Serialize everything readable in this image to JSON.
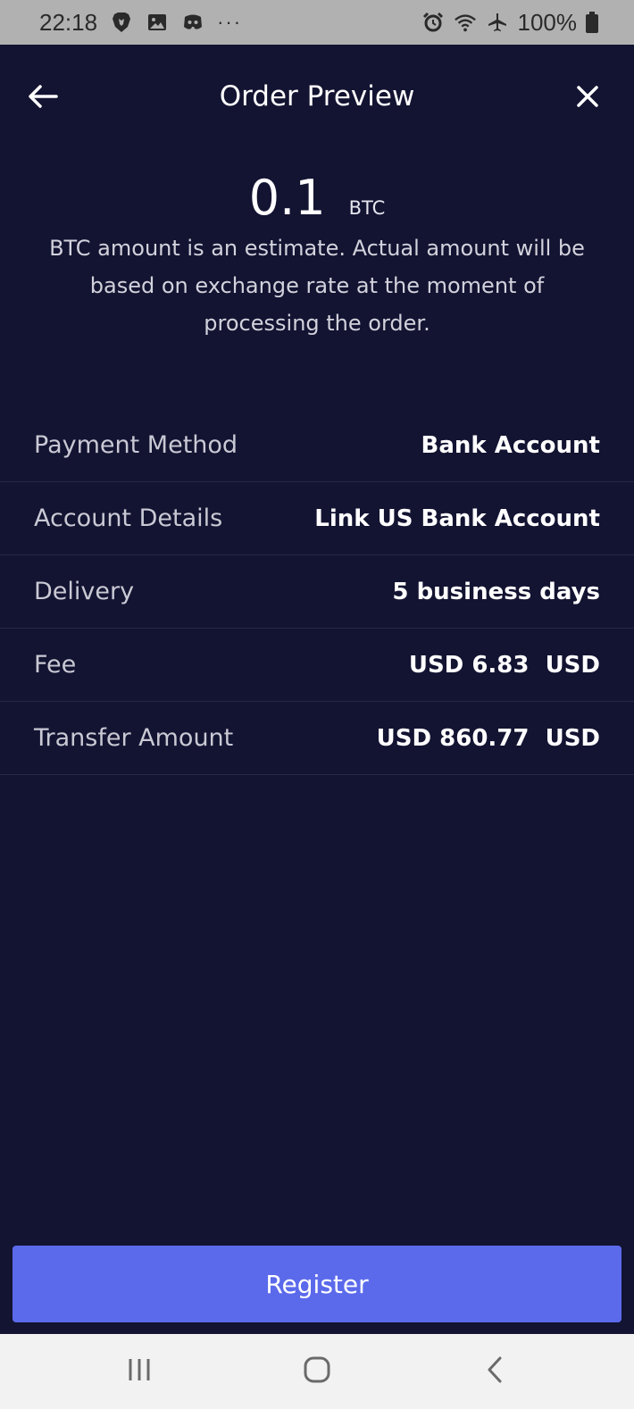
{
  "status_bar": {
    "time": "22:18",
    "more": "···",
    "battery_text": "100%",
    "left_icons": [
      "brave-icon",
      "gallery-icon",
      "discord-icon"
    ],
    "right_icons": [
      "alarm-icon",
      "wifi-icon",
      "airplane-icon",
      "battery-icon"
    ]
  },
  "header": {
    "title": "Order Preview",
    "back_icon": "arrow-left-icon",
    "close_icon": "close-icon"
  },
  "order": {
    "amount": "0.1",
    "unit": "BTC",
    "disclaimer": "BTC amount is an estimate. Actual amount will be based on exchange rate at the moment of processing the order."
  },
  "details": [
    {
      "label": "Payment Method",
      "value": "Bank Account"
    },
    {
      "label": "Account Details",
      "value": "Link US Bank Account"
    },
    {
      "label": "Delivery",
      "value": "5 business days"
    },
    {
      "label": "Fee",
      "value": "USD 6.83  USD"
    },
    {
      "label": "Transfer Amount",
      "value": "USD 860.77  USD"
    }
  ],
  "actions": {
    "register_label": "Register"
  },
  "colors": {
    "background": "#131332",
    "accent": "#5b6aeb",
    "status_bar": "#b1b1b1",
    "nav_bar": "#f2f2f2"
  }
}
